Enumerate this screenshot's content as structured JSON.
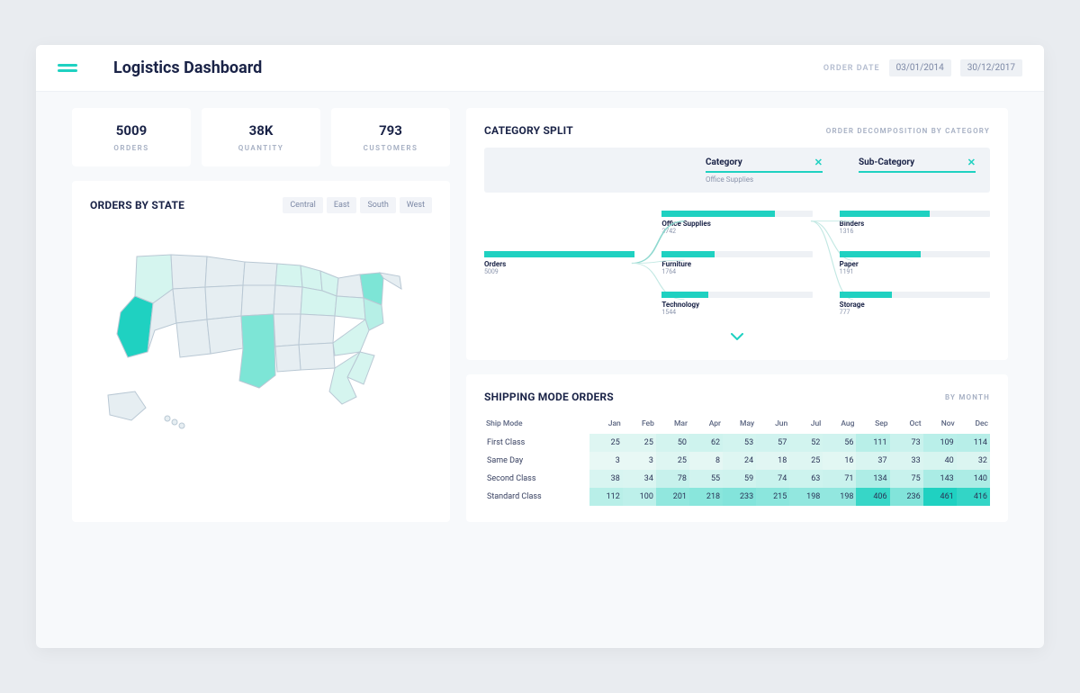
{
  "header": {
    "title": "Logistics Dashboard",
    "order_date_label": "ORDER DATE",
    "date_from": "03/01/2014",
    "date_to": "30/12/2017"
  },
  "stats": [
    {
      "value": "5009",
      "label": "ORDERS"
    },
    {
      "value": "38K",
      "label": "QUANTITY"
    },
    {
      "value": "793",
      "label": "CUSTOMERS"
    }
  ],
  "orders_by_state": {
    "title": "ORDERS BY STATE",
    "regions": [
      "Central",
      "East",
      "South",
      "West"
    ]
  },
  "category_split": {
    "title": "CATEGORY SPLIT",
    "subtitle": "ORDER DECOMPOSITION BY CATEGORY",
    "filters": [
      {
        "label": "Category",
        "value": "Office Supplies"
      },
      {
        "label": "Sub-Category",
        "value": ""
      }
    ],
    "root": {
      "name": "Orders",
      "value": "5009",
      "fill": 100
    },
    "categories": [
      {
        "name": "Office Supplies",
        "value": "3742",
        "fill": 75
      },
      {
        "name": "Furniture",
        "value": "1764",
        "fill": 35
      },
      {
        "name": "Technology",
        "value": "1544",
        "fill": 31
      }
    ],
    "subcategories": [
      {
        "name": "Binders",
        "value": "1316",
        "fill": 60
      },
      {
        "name": "Paper",
        "value": "1191",
        "fill": 54
      },
      {
        "name": "Storage",
        "value": "777",
        "fill": 35
      }
    ]
  },
  "shipping": {
    "title": "SHIPPING MODE ORDERS",
    "subtitle": "BY MONTH",
    "months": [
      "Jan",
      "Feb",
      "Mar",
      "Apr",
      "May",
      "Jun",
      "Jul",
      "Aug",
      "Sep",
      "Oct",
      "Nov",
      "Dec"
    ],
    "ship_mode_header": "Ship Mode"
  },
  "chart_data": {
    "type": "heatmap",
    "title": "Shipping Mode Orders",
    "xlabel": "Month",
    "ylabel": "Ship Mode",
    "categories": [
      "Jan",
      "Feb",
      "Mar",
      "Apr",
      "May",
      "Jun",
      "Jul",
      "Aug",
      "Sep",
      "Oct",
      "Nov",
      "Dec"
    ],
    "series": [
      {
        "name": "First Class",
        "values": [
          25,
          25,
          50,
          62,
          53,
          57,
          52,
          56,
          111,
          73,
          109,
          114
        ]
      },
      {
        "name": "Same Day",
        "values": [
          3,
          3,
          25,
          8,
          24,
          18,
          25,
          16,
          37,
          33,
          40,
          32
        ]
      },
      {
        "name": "Second Class",
        "values": [
          38,
          34,
          78,
          55,
          59,
          74,
          63,
          71,
          134,
          75,
          143,
          140
        ]
      },
      {
        "name": "Standard Class",
        "values": [
          112,
          100,
          201,
          218,
          233,
          215,
          198,
          198,
          406,
          236,
          461,
          416
        ]
      }
    ],
    "color_scale": [
      "#e9f8f5",
      "#1fd1c1"
    ]
  }
}
